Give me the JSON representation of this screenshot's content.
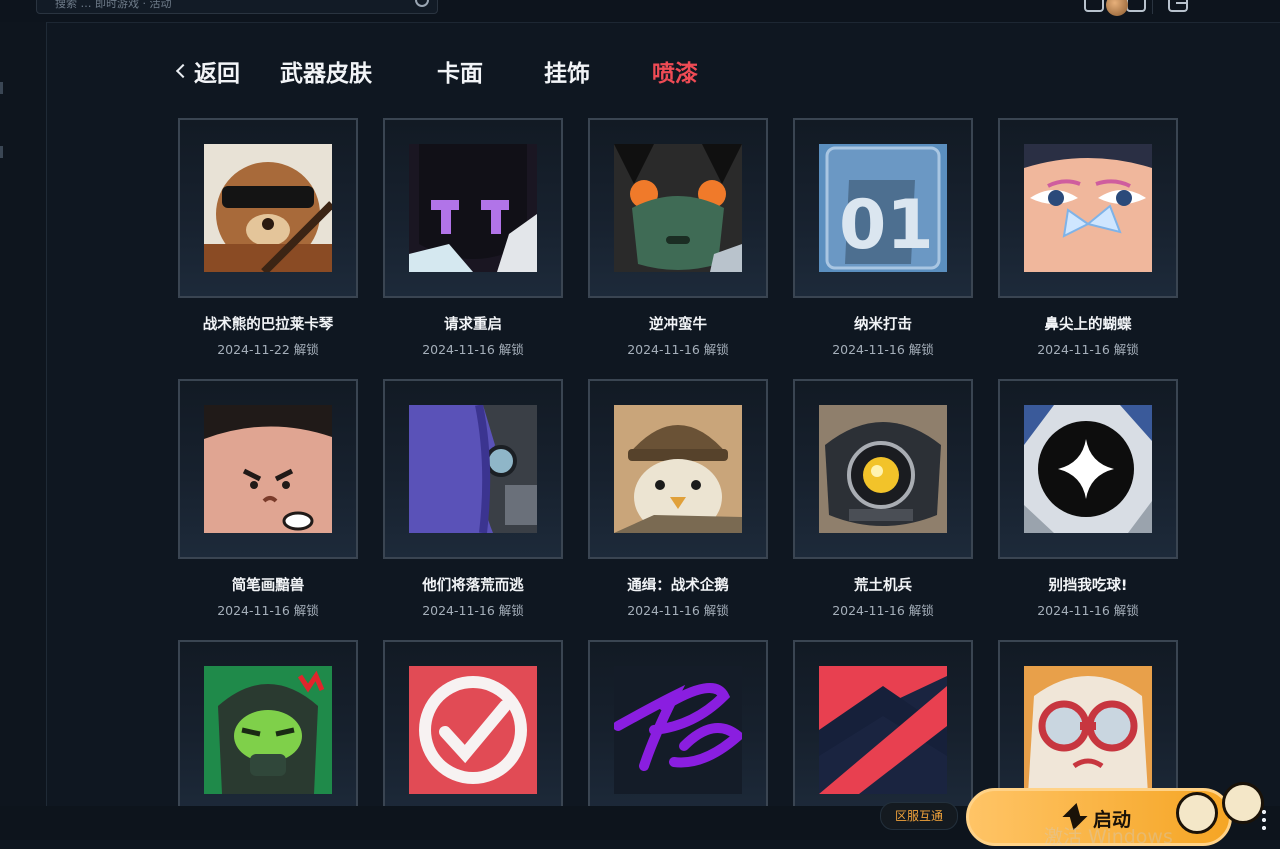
{
  "top_bar": {
    "search_placeholder": "搜索 … 即时游戏 · 活动"
  },
  "nav": {
    "back_label": "返回",
    "tabs": [
      {
        "label": "武器皮肤",
        "active": false
      },
      {
        "label": "卡面",
        "active": false
      },
      {
        "label": "挂饰",
        "active": false
      },
      {
        "label": "喷漆",
        "active": true
      }
    ],
    "active_color": "#ef4b55"
  },
  "sprays": [
    {
      "name": "战术熊的巴拉莱卡琴",
      "date": "2024-11-22 解锁",
      "icon": "tactical-bear-art"
    },
    {
      "name": "请求重启",
      "date": "2024-11-16 解锁",
      "icon": "reboot-robot-art"
    },
    {
      "name": "逆冲蛮牛",
      "date": "2024-11-16 解锁",
      "icon": "brimstone-mask-art"
    },
    {
      "name": "纳米打击",
      "date": "2024-11-16 解锁",
      "icon": "nano-01-card-art"
    },
    {
      "name": "鼻尖上的蝴蝶",
      "date": "2024-11-16 解锁",
      "icon": "butterfly-nose-art"
    },
    {
      "name": "简笔画黯兽",
      "date": "2024-11-16 解锁",
      "icon": "angry-face-art"
    },
    {
      "name": "他们将落荒而逃",
      "date": "2024-11-16 解锁",
      "icon": "fleeing-robot-art"
    },
    {
      "name": "通缉：战术企鹅",
      "date": "2024-11-16 解锁",
      "icon": "tactical-penguin-art"
    },
    {
      "name": "荒土机兵",
      "date": "2024-11-16 解锁",
      "icon": "wasteland-bot-art"
    },
    {
      "name": "别挡我吃球!",
      "date": "2024-11-16 解锁",
      "icon": "star-orb-art"
    },
    {
      "name": "",
      "date": "",
      "icon": "green-soldier-art"
    },
    {
      "name": "",
      "date": "",
      "icon": "red-checkmark-art"
    },
    {
      "name": "",
      "date": "",
      "icon": "purple-signature-art"
    },
    {
      "name": "",
      "date": "",
      "icon": "red-arrow-art"
    },
    {
      "name": "",
      "date": "",
      "icon": "goggles-cat-art"
    }
  ],
  "bottom": {
    "region_label": "区服互通",
    "launch_label": "启动",
    "watermark": "激活 Windows",
    "accent": "#f5a524"
  }
}
